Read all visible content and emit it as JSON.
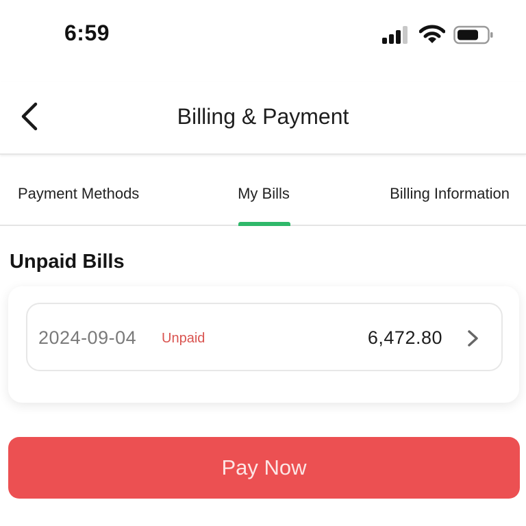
{
  "status_bar": {
    "time": "6:59",
    "icons": [
      "signal-icon",
      "wifi-icon",
      "battery-icon"
    ]
  },
  "header": {
    "back_icon": "chevron-left-icon",
    "title": "Billing & Payment"
  },
  "tabs": [
    {
      "label": "Payment Methods",
      "active": false
    },
    {
      "label": "My Bills",
      "active": true
    },
    {
      "label": "Billing Information",
      "active": false
    }
  ],
  "section": {
    "title": "Unpaid Bills"
  },
  "bills": [
    {
      "date": "2024-09-04",
      "status": "Unpaid",
      "amount": "6,472.80",
      "icon": "chevron-right-icon"
    }
  ],
  "pay_button": {
    "label": "Pay Now"
  },
  "colors": {
    "accent_green": "#2fb86a",
    "status_red": "#d9534f",
    "pay_button": "#ec5052",
    "text_dark": "#1a1a1a",
    "text_gray": "#7a7a7a"
  }
}
